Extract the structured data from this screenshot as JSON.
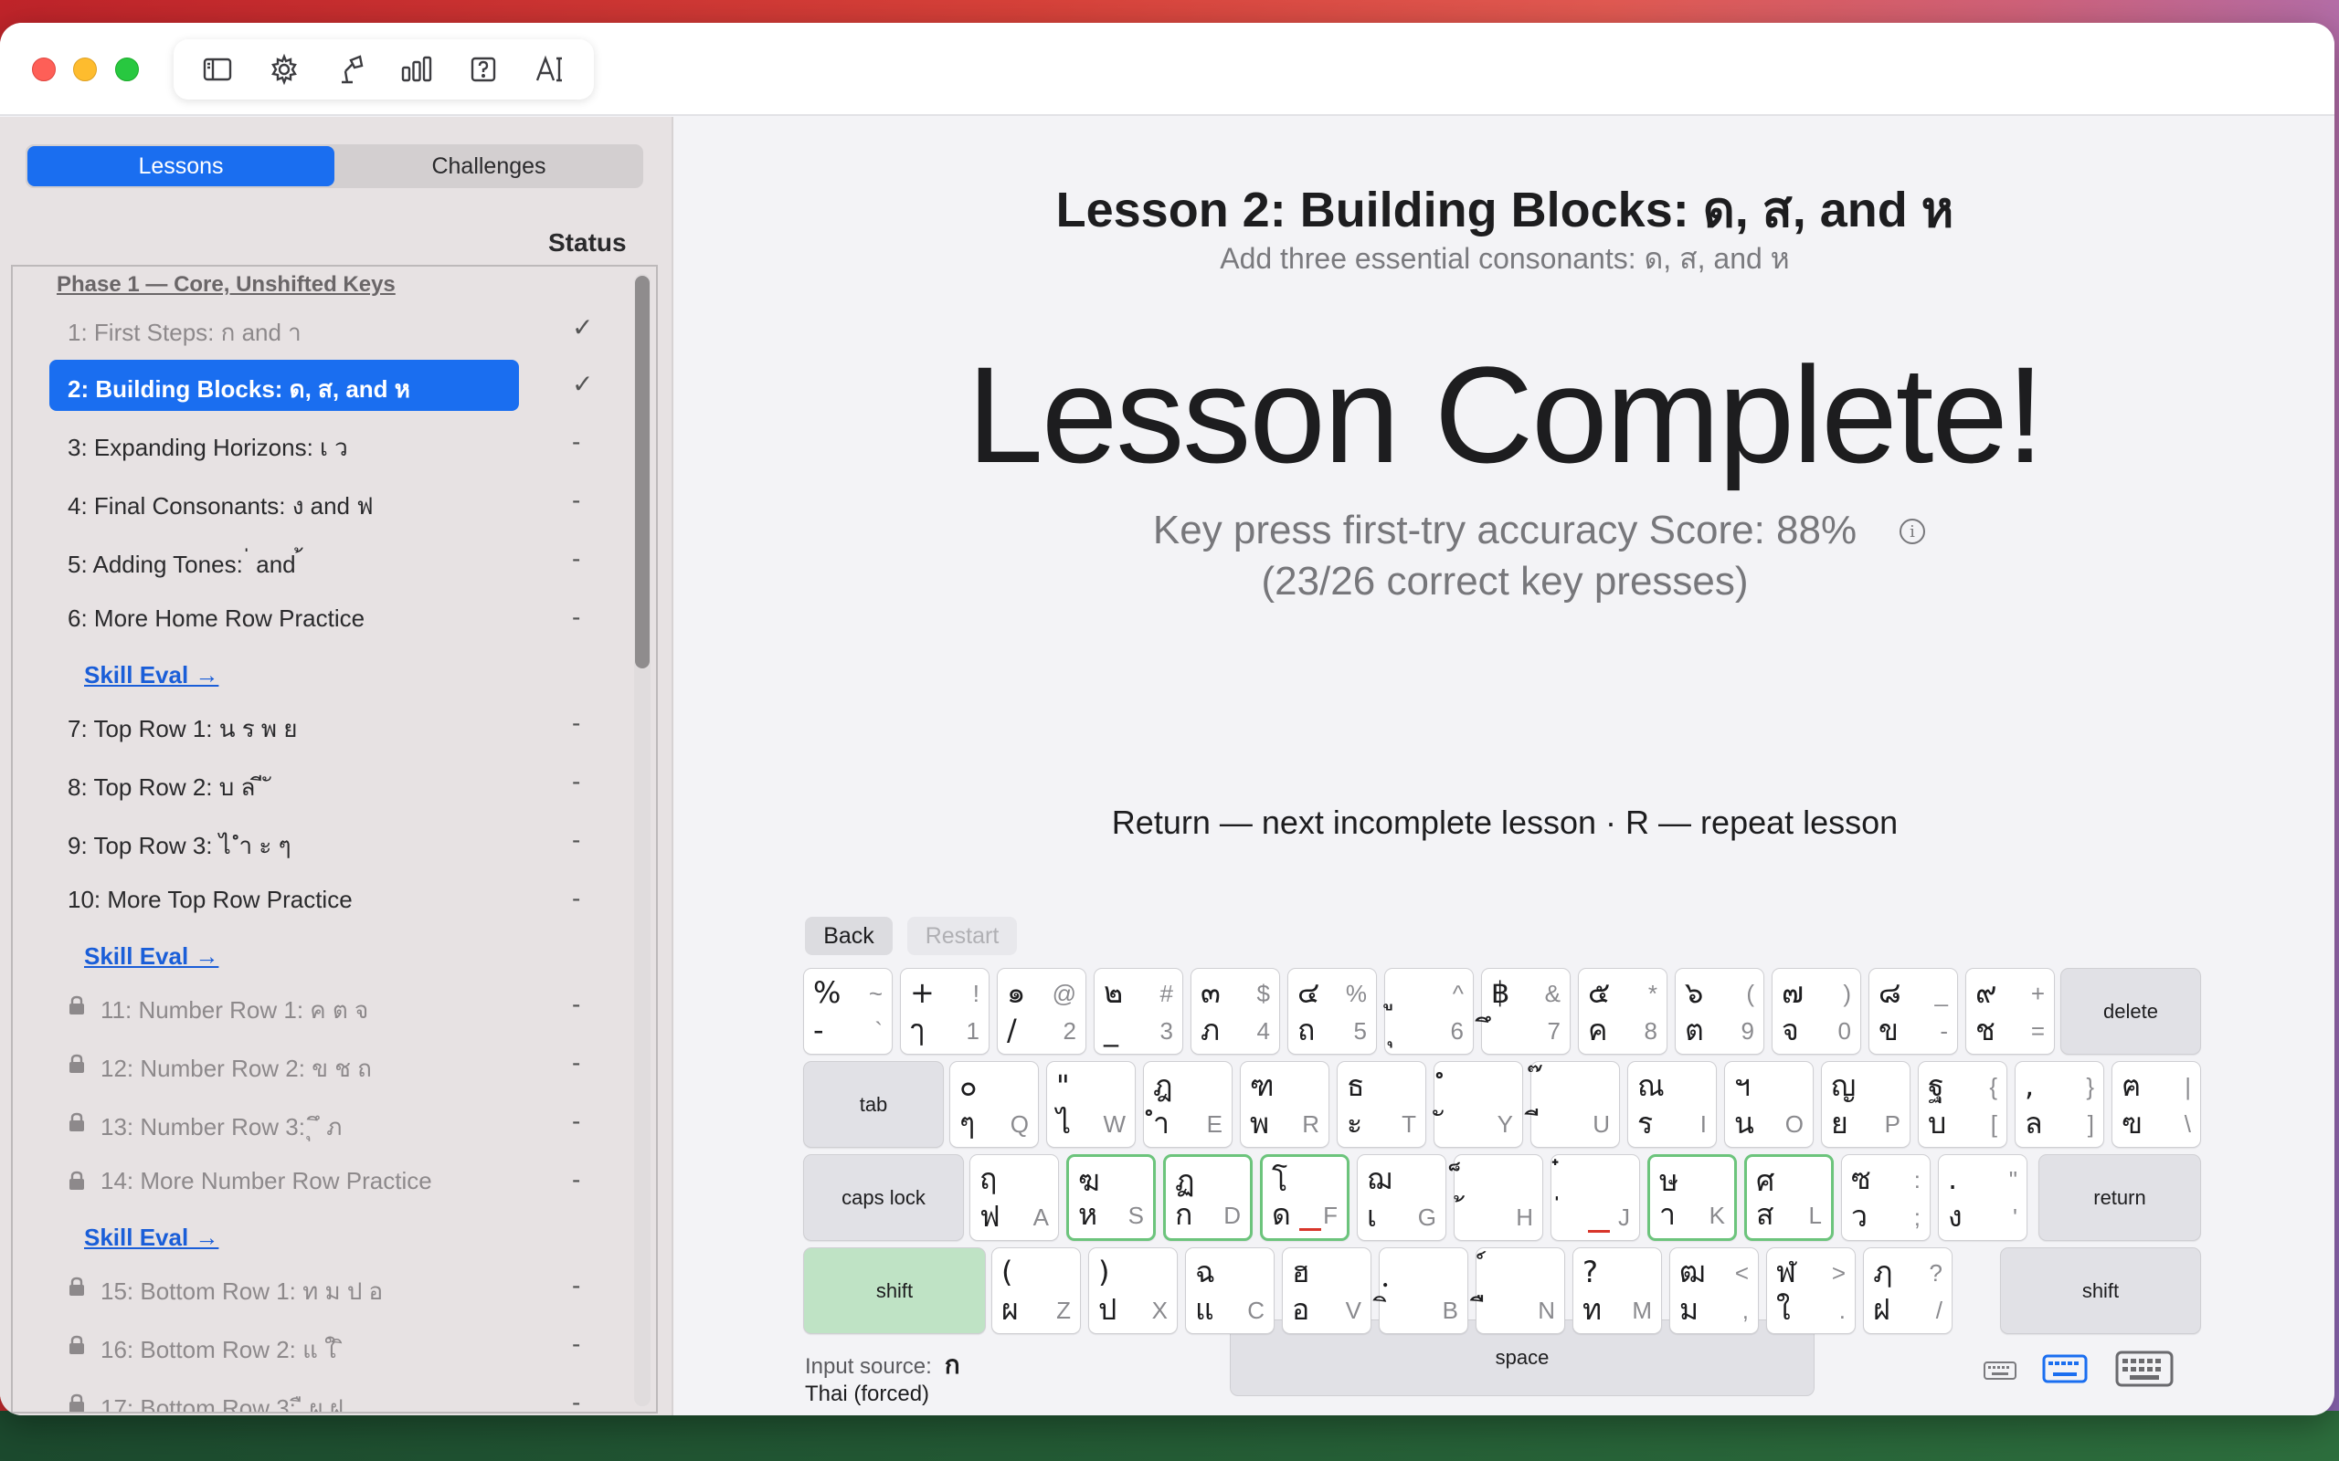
{
  "toolbar": {
    "icons": [
      "sidebar-icon",
      "gear-icon",
      "lamp-icon",
      "stats-icon",
      "help-icon",
      "text-size-icon"
    ]
  },
  "sidebar": {
    "segments": [
      "Lessons",
      "Challenges"
    ],
    "active_segment": "Lessons",
    "status_header": "Status",
    "phase_title": "Phase 1 — Core, Unshifted Keys",
    "skill_eval": "Skill Eval →",
    "items": [
      {
        "label": "1: First Steps: ก and า",
        "status": "✓",
        "state": "done"
      },
      {
        "label": "2: Building Blocks: ด, ส, and ห",
        "status": "✓",
        "state": "selected"
      },
      {
        "label": "3: Expanding Horizons: เ ว",
        "status": "-",
        "state": "open"
      },
      {
        "label": "4: Final Consonants: ง and ฟ",
        "status": "-",
        "state": "open"
      },
      {
        "label": "5: Adding Tones:  ่ and  ้",
        "status": "-",
        "state": "open"
      },
      {
        "label": "6: More Home Row Practice",
        "status": "-",
        "state": "open"
      },
      {
        "label": "7: Top Row 1: น ร พ ย",
        "status": "-",
        "state": "open"
      },
      {
        "label": "8: Top Row 2: บ ล ี ั",
        "status": "-",
        "state": "open"
      },
      {
        "label": "9: Top Row 3: ไ ำ ะ ๆ",
        "status": "-",
        "state": "open"
      },
      {
        "label": "10: More Top Row Practice",
        "status": "-",
        "state": "open"
      },
      {
        "label": "11: Number Row 1: ค ต จ",
        "status": "-",
        "state": "locked"
      },
      {
        "label": "12: Number Row 2: ข ช ถ",
        "status": "-",
        "state": "locked"
      },
      {
        "label": "13: Number Row 3: ุ ึ ภ",
        "status": "-",
        "state": "locked"
      },
      {
        "label": "14: More Number Row Practice",
        "status": "-",
        "state": "locked"
      },
      {
        "label": "15: Bottom Row 1: ท ม ป อ",
        "status": "-",
        "state": "locked"
      },
      {
        "label": "16: Bottom Row 2: แ ใ ิ",
        "status": "-",
        "state": "locked"
      },
      {
        "label": "17: Bottom Row 3: ื ผ ฝ",
        "status": "-",
        "state": "locked"
      }
    ]
  },
  "main": {
    "title": "Lesson 2: Building Blocks: ด, ส, and ห",
    "subtitle": "Add three essential consonants: ด, ส, and ห",
    "complete": "Lesson Complete!",
    "score_line1": "Key press first-try accuracy Score: 88%",
    "score_line2": "(23/26 correct key presses)",
    "info_glyph": "i",
    "hint": "Return — next incomplete lesson  ·  R — repeat lesson",
    "back": "Back",
    "restart": "Restart"
  },
  "keyboard": {
    "row1": [
      {
        "tl": "%",
        "ts": "~",
        "bl": "-",
        "br": "`"
      },
      {
        "tl": "+",
        "ts": "!",
        "bl": "ๅ",
        "br": "1"
      },
      {
        "tl": "๑",
        "ts": "@",
        "bl": "/",
        "br": "2"
      },
      {
        "tl": "๒",
        "ts": "#",
        "bl": "_",
        "br": "3"
      },
      {
        "tl": "๓",
        "ts": "$",
        "bl": "ภ",
        "br": "4"
      },
      {
        "tl": "๔",
        "ts": "%",
        "bl": "ถ",
        "br": "5"
      },
      {
        "tl": "ู",
        "ts": "^",
        "bl": "ุ",
        "br": "6"
      },
      {
        "tl": "฿",
        "ts": "&",
        "bl": "ึ",
        "br": "7"
      },
      {
        "tl": "๕",
        "ts": "*",
        "bl": "ค",
        "br": "8"
      },
      {
        "tl": "๖",
        "ts": "(",
        "bl": "ต",
        "br": "9"
      },
      {
        "tl": "๗",
        "ts": ")",
        "bl": "จ",
        "br": "0"
      },
      {
        "tl": "๘",
        "ts": "_",
        "bl": "ข",
        "br": "-"
      },
      {
        "tl": "๙",
        "ts": "+",
        "bl": "ช",
        "br": "="
      }
    ],
    "row2": [
      {
        "tl": "๐",
        "ts": "",
        "bl": "ๆ",
        "br": "Q"
      },
      {
        "tl": "\"",
        "ts": "",
        "bl": "ไ",
        "br": "W"
      },
      {
        "tl": "ฎ",
        "ts": "",
        "bl": "ำ",
        "br": "E"
      },
      {
        "tl": "ฑ",
        "ts": "",
        "bl": "พ",
        "br": "R"
      },
      {
        "tl": "ธ",
        "ts": "",
        "bl": "ะ",
        "br": "T"
      },
      {
        "tl": "ํ",
        "ts": "",
        "bl": "ั",
        "br": "Y"
      },
      {
        "tl": "๊",
        "ts": "",
        "bl": "ี",
        "br": "U"
      },
      {
        "tl": "ณ",
        "ts": "",
        "bl": "ร",
        "br": "I"
      },
      {
        "tl": "ฯ",
        "ts": "",
        "bl": "น",
        "br": "O"
      },
      {
        "tl": "ญ",
        "ts": "",
        "bl": "ย",
        "br": "P"
      },
      {
        "tl": "ฐ",
        "ts": "{",
        "bl": "บ",
        "br": "["
      },
      {
        "tl": ",",
        "ts": "}",
        "bl": "ล",
        "br": "]"
      },
      {
        "tl": "ฅ",
        "ts": "|",
        "bl": "ฃ",
        "br": "\\"
      }
    ],
    "row3": [
      {
        "tl": "ฤ",
        "ts": "",
        "bl": "ฟ",
        "br": "A"
      },
      {
        "tl": "ฆ",
        "ts": "",
        "bl": "ห",
        "br": "S"
      },
      {
        "tl": "ฏ",
        "ts": "",
        "bl": "ก",
        "br": "D"
      },
      {
        "tl": "โ",
        "ts": "",
        "bl": "ด",
        "br": "F"
      },
      {
        "tl": "ฌ",
        "ts": "",
        "bl": "เ",
        "br": "G"
      },
      {
        "tl": "็",
        "ts": "",
        "bl": "้",
        "br": "H"
      },
      {
        "tl": "๋",
        "ts": "",
        "bl": "่",
        "br": "J"
      },
      {
        "tl": "ษ",
        "ts": "",
        "bl": "า",
        "br": "K"
      },
      {
        "tl": "ศ",
        "ts": "",
        "bl": "ส",
        "br": "L"
      },
      {
        "tl": "ซ",
        "ts": ":",
        "bl": "ว",
        "br": ";"
      },
      {
        "tl": ".",
        "ts": "\"",
        "bl": "ง",
        "br": "'"
      }
    ],
    "row4": [
      {
        "tl": "(",
        "ts": "",
        "bl": "ผ",
        "br": "Z"
      },
      {
        "tl": ")",
        "ts": "",
        "bl": "ป",
        "br": "X"
      },
      {
        "tl": "ฉ",
        "ts": "",
        "bl": "แ",
        "br": "C"
      },
      {
        "tl": "ฮ",
        "ts": "",
        "bl": "อ",
        "br": "V"
      },
      {
        "tl": "ฺ",
        "ts": "",
        "bl": "ิ",
        "br": "B"
      },
      {
        "tl": "์",
        "ts": "",
        "bl": "ื",
        "br": "N"
      },
      {
        "tl": "?",
        "ts": "",
        "bl": "ท",
        "br": "M"
      },
      {
        "tl": "ฒ",
        "ts": "<",
        "bl": "ม",
        "br": ","
      },
      {
        "tl": "ฬ",
        "ts": ">",
        "bl": "ใ",
        "br": "."
      },
      {
        "tl": "ฦ",
        "ts": "?",
        "bl": "ฝ",
        "br": "/"
      }
    ],
    "delete": "delete",
    "tab": "tab",
    "caps": "caps lock",
    "return": "return",
    "shift_left": "shift",
    "shift_right": "shift",
    "space": "space",
    "highlighted": [
      "S",
      "D",
      "F",
      "K",
      "L"
    ],
    "home_marks": [
      "F",
      "J"
    ],
    "input_source_label": "Input source:",
    "input_source_glyph": "ก",
    "input_source_value": "Thai (forced)",
    "size_icons": [
      "keyboard-small-icon",
      "keyboard-medium-icon",
      "keyboard-large-icon"
    ],
    "size_selected": "keyboard-medium-icon",
    "accent": "#1a6ef0",
    "highlight_color": "#6cc47c",
    "shift_active_color": "#bfe3c5"
  }
}
